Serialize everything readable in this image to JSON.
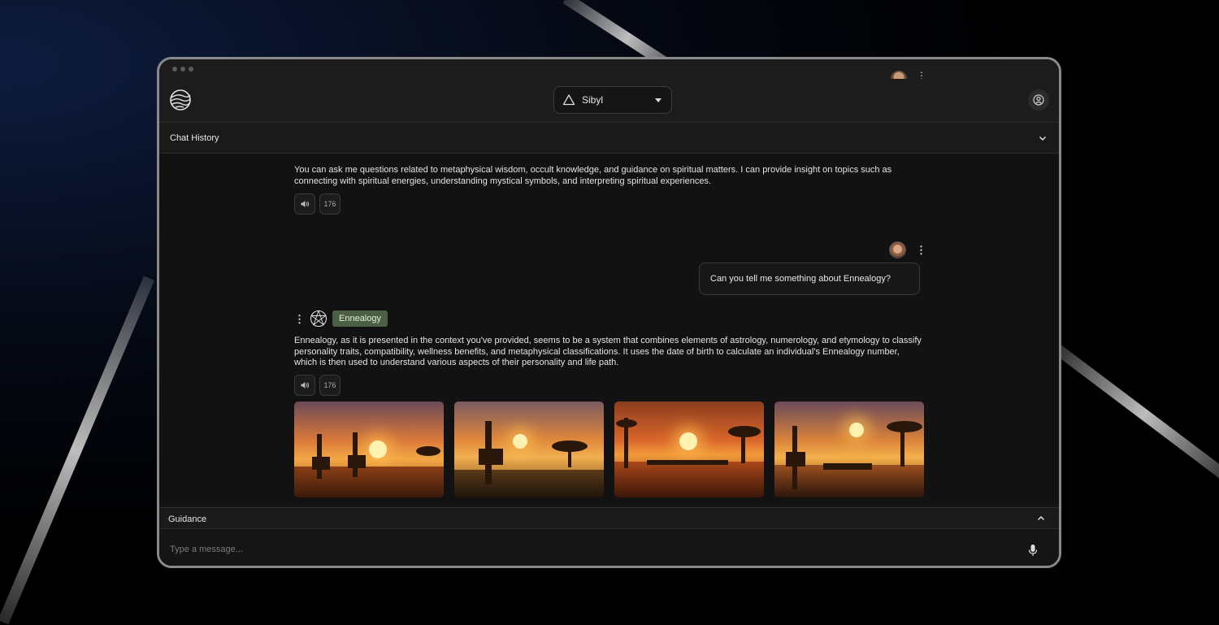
{
  "app": {
    "model_selector": "Sibyl",
    "chat_history_label": "Chat History",
    "guidance_label": "Guidance",
    "input_placeholder": "Type a message..."
  },
  "messages": {
    "bot1_text": "You can ask me questions related to metaphysical wisdom, occult knowledge, and guidance on spiritual matters. I can provide insight on topics such as connecting with spiritual energies, understanding mystical symbols, and interpreting spiritual experiences.",
    "bot1_count": "176",
    "user_text": "Can you tell me something about Ennealogy?",
    "bot2_tag": "Ennealogy",
    "bot2_text": "Ennealogy, as it is presented in the context you've provided, seems to be a system that combines elements of astrology, numerology, and etymology to classify personality traits, compatibility, wellness benefits, and metaphysical classifications. It uses the date of birth to calculate an individual's Ennealogy number, which is then used to understand various aspects of their personality and life path.",
    "bot2_count": "176"
  },
  "icons": {
    "logo": "globe-logo-icon",
    "model": "triangle-icon",
    "account": "user-circle-icon",
    "speaker": "speaker-icon",
    "mic": "microphone-icon",
    "bot_avatar": "enneagram-icon"
  },
  "colors": {
    "tag_bg": "#4b5f45",
    "accent_sunset": "#e8892a"
  }
}
